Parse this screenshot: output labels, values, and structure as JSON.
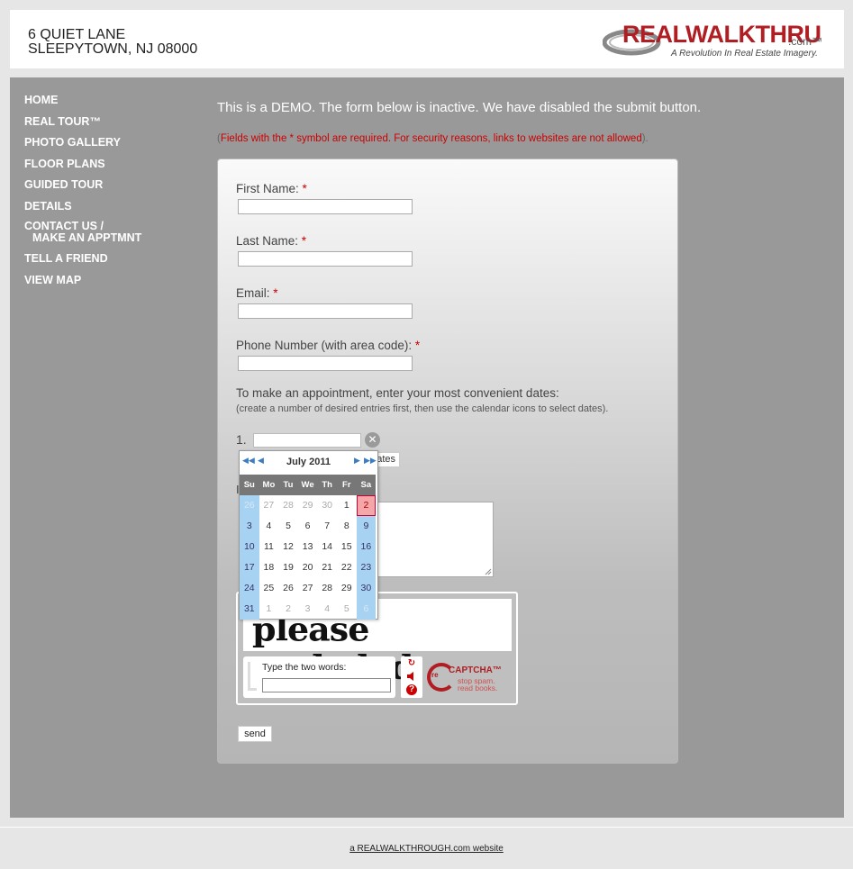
{
  "header": {
    "address_line1": "6 QUIET LANE",
    "address_line2": "SLEEPYTOWN, NJ 08000",
    "logo_text": "REALWALKTHRU",
    "logo_com": ".com™",
    "logo_tagline": "A Revolution In Real Estate Imagery."
  },
  "nav": {
    "items": [
      "HOME",
      "REAL TOUR™",
      "PHOTO GALLERY",
      "FLOOR PLANS",
      "GUIDED TOUR",
      "DETAILS"
    ],
    "contact_line1": "CONTACT US /",
    "contact_line2": "MAKE AN APPTMNT",
    "items_after": [
      "TELL A FRIEND",
      "VIEW MAP"
    ]
  },
  "main": {
    "demo_notice": "This is a DEMO. The form below is inactive. We have disabled the submit button.",
    "required_note": "Fields with the * symbol are required. For security reasons, links to websites are not allowed"
  },
  "form": {
    "first_name_label": "First Name:",
    "last_name_label": "Last Name:",
    "email_label": "Email:",
    "phone_label": "Phone Number (with area code):",
    "required_star": "*",
    "appointment_label": "To make an appointment, enter your most convenient dates:",
    "appointment_sub": "(create a number of desired entries first, then use the calendar icons to select dates).",
    "entry_number": "1.",
    "clear_icon": "✕",
    "dates_button_partial": "ates",
    "message_label_partial": "I",
    "send_label": "send"
  },
  "calendar": {
    "month_title": "July 2011",
    "nav_prev_year": "◀◀",
    "nav_prev_month": "◀",
    "nav_next_month": "▶",
    "nav_next_year": "▶▶",
    "days_of_week": [
      "Su",
      "Mo",
      "Tu",
      "We",
      "Th",
      "Fr",
      "Sa"
    ],
    "weeks": [
      [
        "26",
        "27",
        "28",
        "29",
        "30",
        "1",
        "2"
      ],
      [
        "3",
        "4",
        "5",
        "6",
        "7",
        "8",
        "9"
      ],
      [
        "10",
        "11",
        "12",
        "13",
        "14",
        "15",
        "16"
      ],
      [
        "17",
        "18",
        "19",
        "20",
        "21",
        "22",
        "23"
      ],
      [
        "24",
        "25",
        "26",
        "27",
        "28",
        "29",
        "30"
      ],
      [
        "31",
        "1",
        "2",
        "3",
        "4",
        "5",
        "6"
      ]
    ],
    "today": "2"
  },
  "recaptcha": {
    "challenge_words": "please entheled",
    "prompt": "Type the two words:",
    "brand_re": "re",
    "brand_name": "CAPTCHA™",
    "brand_line1": "stop spam.",
    "brand_line2": "read books.",
    "reload_icon": "↻",
    "audio_icon": "🔊",
    "help_icon": "?"
  },
  "footer": {
    "link_text": "a REALWALKTHROUGH.com website"
  },
  "colors": {
    "accent_red": "#b01e23",
    "panel_gray": "#999999",
    "weekend_blue": "#a8d2f2",
    "today_pink": "#f4a6a8"
  }
}
